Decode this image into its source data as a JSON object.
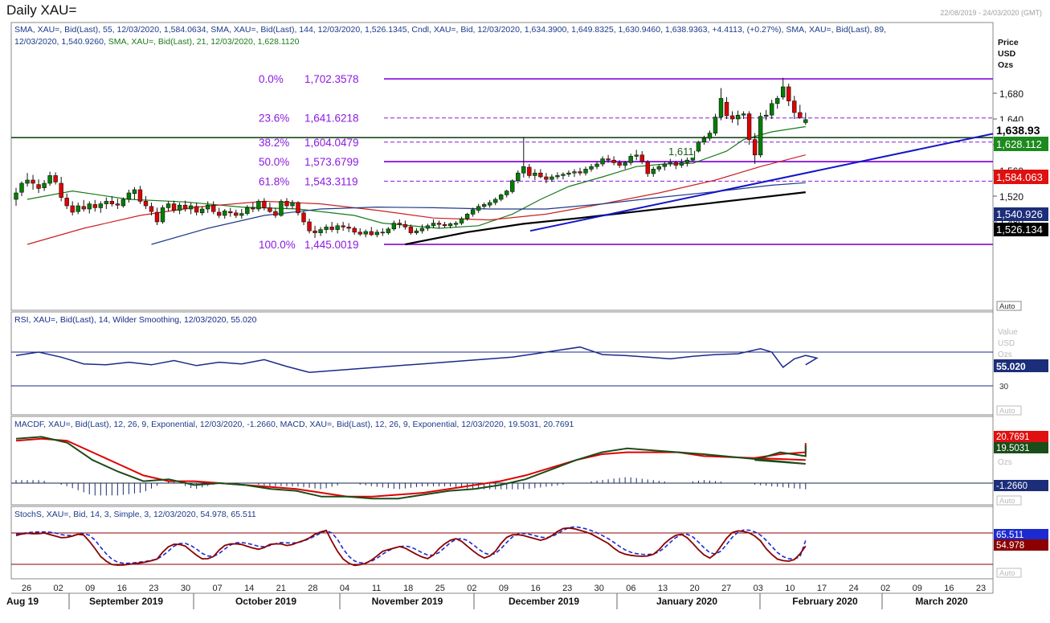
{
  "window": {
    "title": "Daily XAU=",
    "date_range": "22/08/2019 - 24/03/2020 (GMT)"
  },
  "colors": {
    "up": "#008000",
    "down": "#e00000",
    "fib": "#8c1ae0",
    "trend": "#1515c8",
    "sma21": "#1a7a1a",
    "sma55": "#cc2020",
    "sma89": "#1f3a8a",
    "sma144": "#000000",
    "macd": "#e00000",
    "macd_signal": "#1a4d1a",
    "rsi": "#1a2a8a",
    "stoch_k": "#8b0000",
    "stoch_d": "#1c2bd0"
  },
  "main_panel": {
    "legend_line1": "SMA, XAU=, Bid(Last), 55, 12/03/2020, 1,584.0634, SMA, XAU=, Bid(Last), 144, 12/03/2020, 1,526.1345, Cndl, XAU=, Bid, 12/03/2020, 1,634.3900, 1,649.8325, 1,630.9460, 1,638.9363, +4.4113, (+0.27%), SMA, XAU=, Bid(Last), 89,",
    "legend_line2_a": "12/03/2020, 1,540.9260, ",
    "legend_line2_b": "SMA, XAU=, Bid(Last), 21, 12/03/2020, 1,628.1120",
    "axis_title": [
      "Price",
      "USD",
      "Ozs"
    ],
    "auto_label": "Auto",
    "level_1611_label": "1,611",
    "current_price_label": "1,638.93",
    "sma21_label": "1,628.112",
    "sma55_label": "1,584.063",
    "sma89_label": "1,540.926",
    "sma144_label": "1,526.134",
    "fib_levels": [
      {
        "pct": "0.0%",
        "value_text": "1,702.3578",
        "value": 1702.3578,
        "dashed": false
      },
      {
        "pct": "23.6%",
        "value_text": "1,641.6218",
        "value": 1641.6218,
        "dashed": true
      },
      {
        "pct": "38.2%",
        "value_text": "1,604.0479",
        "value": 1604.0479,
        "dashed": true
      },
      {
        "pct": "50.0%",
        "value_text": "1,573.6799",
        "value": 1573.6799,
        "dashed": false
      },
      {
        "pct": "61.8%",
        "value_text": "1,543.3119",
        "value": 1543.3119,
        "dashed": true
      },
      {
        "pct": "100.0%",
        "value_text": "1,445.0019",
        "value": 1445.0019,
        "dashed": false
      }
    ]
  },
  "rsi_panel": {
    "legend": "RSI, XAU=, Bid(Last), 14, Wilder Smoothing, 12/03/2020, 55.020",
    "axis_title": [
      "Value",
      "USD",
      "Ozs"
    ],
    "value_label": "55.020",
    "tick_30": "30",
    "auto_label": "Auto"
  },
  "macd_panel": {
    "legend": "MACDF, XAU=, Bid(Last), 12, 26, 9, Exponential, 12/03/2020, -1.2660, MACD, XAU=, Bid(Last), 12, 26, 9, Exponential, 12/03/2020, 19.5031, 20.7691",
    "macd_label": "20.7691",
    "signal_label": "19.5031",
    "hist_label": "-1.2660",
    "ozs": "Ozs",
    "auto_label": "Auto"
  },
  "stoch_panel": {
    "legend": "StochS, XAU=, Bid, 14, 3, Simple, 3, 12/03/2020, 54.978, 65.511",
    "k_label": "54.978",
    "d_label": "65.511",
    "auto_label": "Auto"
  },
  "x_axis": {
    "day_ticks": [
      "26",
      "02",
      "09",
      "16",
      "23",
      "30",
      "07",
      "14",
      "21",
      "28",
      "04",
      "11",
      "18",
      "25",
      "02",
      "09",
      "16",
      "23",
      "30",
      "06",
      "13",
      "20",
      "27",
      "03",
      "10",
      "17",
      "24",
      "02",
      "09",
      "16",
      "23"
    ],
    "months": [
      "Aug 19",
      "September 2019",
      "October 2019",
      "November 2019",
      "December 2019",
      "January 2020",
      "February 2020",
      "March 2020"
    ]
  },
  "chart_data": {
    "type": "candlestick",
    "title": "Daily XAU=",
    "ylabel": "Price USD Ozs",
    "ylim": [
      1445,
      1720
    ],
    "y_ticks": [
      1480,
      1520,
      1560,
      1600,
      1640,
      1680
    ],
    "y_tick_labels": [
      "1,480",
      "1,520",
      "1,560",
      "1,600",
      "1,640",
      "1,680"
    ],
    "x_range": [
      "2019-08-23",
      "2020-03-12"
    ],
    "candles_ohlc": [
      [
        1515,
        1533,
        1505,
        1525
      ],
      [
        1526,
        1543,
        1520,
        1540
      ],
      [
        1540,
        1556,
        1535,
        1545
      ],
      [
        1545,
        1553,
        1530,
        1540
      ],
      [
        1538,
        1546,
        1525,
        1532
      ],
      [
        1533,
        1545,
        1528,
        1540
      ],
      [
        1540,
        1558,
        1536,
        1552
      ],
      [
        1552,
        1557,
        1538,
        1542
      ],
      [
        1540,
        1550,
        1512,
        1518
      ],
      [
        1517,
        1524,
        1500,
        1505
      ],
      [
        1505,
        1512,
        1490,
        1495
      ],
      [
        1496,
        1510,
        1492,
        1505
      ],
      [
        1504,
        1514,
        1496,
        1500
      ],
      [
        1500,
        1512,
        1493,
        1508
      ],
      [
        1507,
        1514,
        1496,
        1502
      ],
      [
        1502,
        1512,
        1494,
        1508
      ],
      [
        1508,
        1518,
        1500,
        1512
      ],
      [
        1512,
        1520,
        1504,
        1508
      ],
      [
        1508,
        1516,
        1500,
        1506
      ],
      [
        1505,
        1518,
        1502,
        1515
      ],
      [
        1515,
        1530,
        1510,
        1525
      ],
      [
        1524,
        1534,
        1515,
        1530
      ],
      [
        1530,
        1536,
        1508,
        1512
      ],
      [
        1512,
        1520,
        1500,
        1505
      ],
      [
        1504,
        1510,
        1490,
        1496
      ],
      [
        1495,
        1502,
        1475,
        1480
      ],
      [
        1480,
        1506,
        1477,
        1502
      ],
      [
        1502,
        1512,
        1496,
        1508
      ],
      [
        1508,
        1513,
        1494,
        1498
      ],
      [
        1498,
        1510,
        1492,
        1506
      ],
      [
        1506,
        1513,
        1496,
        1500
      ],
      [
        1500,
        1510,
        1492,
        1505
      ],
      [
        1504,
        1510,
        1490,
        1495
      ],
      [
        1494,
        1504,
        1490,
        1500
      ],
      [
        1500,
        1512,
        1494,
        1506
      ],
      [
        1506,
        1512,
        1492,
        1496
      ],
      [
        1495,
        1502,
        1486,
        1490
      ],
      [
        1490,
        1500,
        1485,
        1497
      ],
      [
        1496,
        1502,
        1488,
        1494
      ],
      [
        1494,
        1499,
        1486,
        1490
      ],
      [
        1490,
        1500,
        1485,
        1493
      ],
      [
        1493,
        1506,
        1490,
        1502
      ],
      [
        1502,
        1510,
        1495,
        1500
      ],
      [
        1500,
        1515,
        1496,
        1512
      ],
      [
        1512,
        1517,
        1498,
        1502
      ],
      [
        1502,
        1510,
        1494,
        1496
      ],
      [
        1496,
        1502,
        1486,
        1490
      ],
      [
        1490,
        1515,
        1488,
        1512
      ],
      [
        1512,
        1517,
        1500,
        1505
      ],
      [
        1505,
        1514,
        1500,
        1510
      ],
      [
        1510,
        1512,
        1490,
        1494
      ],
      [
        1494,
        1497,
        1475,
        1480
      ],
      [
        1480,
        1485,
        1462,
        1466
      ],
      [
        1466,
        1474,
        1455,
        1463
      ],
      [
        1463,
        1472,
        1458,
        1468
      ],
      [
        1468,
        1476,
        1462,
        1472
      ],
      [
        1472,
        1480,
        1464,
        1468
      ],
      [
        1468,
        1478,
        1462,
        1474
      ],
      [
        1474,
        1480,
        1466,
        1472
      ],
      [
        1472,
        1478,
        1464,
        1470
      ],
      [
        1470,
        1473,
        1460,
        1464
      ],
      [
        1464,
        1470,
        1458,
        1461
      ],
      [
        1461,
        1468,
        1456,
        1465
      ],
      [
        1465,
        1472,
        1458,
        1460
      ],
      [
        1460,
        1468,
        1456,
        1464
      ],
      [
        1464,
        1470,
        1458,
        1463
      ],
      [
        1463,
        1472,
        1460,
        1469
      ],
      [
        1469,
        1482,
        1466,
        1478
      ],
      [
        1478,
        1484,
        1470,
        1476
      ],
      [
        1476,
        1482,
        1468,
        1472
      ],
      [
        1472,
        1476,
        1460,
        1463
      ],
      [
        1463,
        1470,
        1460,
        1466
      ],
      [
        1466,
        1476,
        1462,
        1470
      ],
      [
        1470,
        1477,
        1466,
        1474
      ],
      [
        1474,
        1484,
        1470,
        1478
      ],
      [
        1478,
        1482,
        1470,
        1476
      ],
      [
        1476,
        1480,
        1471,
        1474
      ],
      [
        1474,
        1479,
        1470,
        1477
      ],
      [
        1476,
        1481,
        1472,
        1478
      ],
      [
        1478,
        1488,
        1475,
        1485
      ],
      [
        1485,
        1494,
        1482,
        1492
      ],
      [
        1492,
        1502,
        1488,
        1499
      ],
      [
        1498,
        1508,
        1494,
        1504
      ],
      [
        1504,
        1510,
        1500,
        1507
      ],
      [
        1506,
        1514,
        1502,
        1510
      ],
      [
        1510,
        1518,
        1506,
        1515
      ],
      [
        1515,
        1524,
        1512,
        1522
      ],
      [
        1522,
        1530,
        1518,
        1528
      ],
      [
        1527,
        1546,
        1524,
        1544
      ],
      [
        1544,
        1560,
        1540,
        1556
      ],
      [
        1556,
        1612,
        1549,
        1566
      ],
      [
        1565,
        1570,
        1548,
        1552
      ],
      [
        1552,
        1562,
        1545,
        1556
      ],
      [
        1556,
        1562,
        1548,
        1550
      ],
      [
        1550,
        1556,
        1540,
        1546
      ],
      [
        1546,
        1554,
        1542,
        1550
      ],
      [
        1550,
        1557,
        1546,
        1552
      ],
      [
        1552,
        1557,
        1546,
        1554
      ],
      [
        1554,
        1560,
        1550,
        1556
      ],
      [
        1556,
        1562,
        1550,
        1558
      ],
      [
        1558,
        1564,
        1552,
        1556
      ],
      [
        1556,
        1566,
        1552,
        1562
      ],
      [
        1562,
        1570,
        1558,
        1566
      ],
      [
        1566,
        1574,
        1562,
        1570
      ],
      [
        1570,
        1582,
        1566,
        1578
      ],
      [
        1578,
        1584,
        1572,
        1576
      ],
      [
        1576,
        1582,
        1568,
        1572
      ],
      [
        1572,
        1576,
        1564,
        1568
      ],
      [
        1568,
        1575,
        1562,
        1572
      ],
      [
        1572,
        1586,
        1568,
        1582
      ],
      [
        1582,
        1592,
        1576,
        1584
      ],
      [
        1584,
        1590,
        1570,
        1574
      ],
      [
        1573,
        1576,
        1550,
        1555
      ],
      [
        1555,
        1566,
        1550,
        1562
      ],
      [
        1562,
        1570,
        1558,
        1566
      ],
      [
        1566,
        1574,
        1560,
        1570
      ],
      [
        1570,
        1578,
        1566,
        1572
      ],
      [
        1572,
        1575,
        1562,
        1568
      ],
      [
        1568,
        1578,
        1564,
        1572
      ],
      [
        1572,
        1580,
        1566,
        1576
      ],
      [
        1576,
        1592,
        1574,
        1590
      ],
      [
        1590,
        1606,
        1588,
        1604
      ],
      [
        1604,
        1614,
        1600,
        1610
      ],
      [
        1610,
        1622,
        1606,
        1618
      ],
      [
        1618,
        1648,
        1614,
        1643
      ],
      [
        1643,
        1688,
        1638,
        1672
      ],
      [
        1666,
        1674,
        1640,
        1645
      ],
      [
        1645,
        1652,
        1634,
        1640
      ],
      [
        1640,
        1653,
        1630,
        1646
      ],
      [
        1646,
        1652,
        1640,
        1648
      ],
      [
        1648,
        1652,
        1600,
        1608
      ],
      [
        1608,
        1618,
        1570,
        1584
      ],
      [
        1584,
        1650,
        1580,
        1644
      ],
      [
        1644,
        1654,
        1638,
        1646
      ],
      [
        1646,
        1670,
        1640,
        1664
      ],
      [
        1664,
        1676,
        1656,
        1672
      ],
      [
        1674,
        1704,
        1670,
        1690
      ],
      [
        1690,
        1695,
        1660,
        1668
      ],
      [
        1668,
        1676,
        1640,
        1650
      ],
      [
        1650,
        1662,
        1640,
        1642
      ],
      [
        1634.39,
        1649.83,
        1630.95,
        1638.94
      ]
    ],
    "series": [
      {
        "name": "SMA 21",
        "last": 1628.112
      },
      {
        "name": "SMA 55",
        "last": 1584.0634
      },
      {
        "name": "SMA 89",
        "last": 1540.926
      },
      {
        "name": "SMA 144",
        "last": 1526.1345
      }
    ],
    "horizontal_level": 1611,
    "rsi": {
      "last": 55.02,
      "ylim": [
        30,
        80
      ],
      "overbought": 70
    },
    "macd": {
      "macd_last": 20.7691,
      "signal_last": 19.5031,
      "hist_last": -1.266
    },
    "stochastic": {
      "k_last": 54.978,
      "d_last": 65.511,
      "upper": 80,
      "lower": 20
    }
  }
}
